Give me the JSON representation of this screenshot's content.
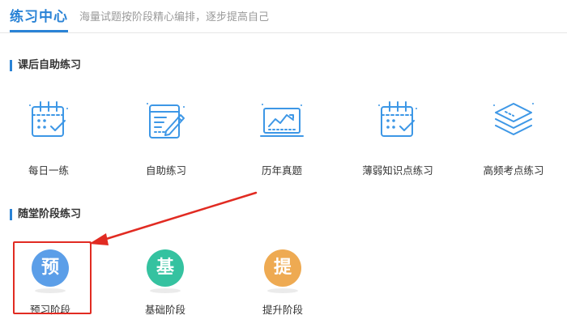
{
  "header": {
    "title": "练习中心",
    "subtitle": "海量试题按阶段精心编排，逐步提高自己"
  },
  "section_after_class": {
    "title": "课后自助练习",
    "items": [
      {
        "label": "每日一练",
        "icon": "calendar-check-icon"
      },
      {
        "label": "自助练习",
        "icon": "form-pencil-icon"
      },
      {
        "label": "历年真题",
        "icon": "chart-monitor-icon"
      },
      {
        "label": "薄弱知识点练习",
        "icon": "calendar-check-icon"
      },
      {
        "label": "高频考点练习",
        "icon": "layers-icon"
      }
    ]
  },
  "section_stage": {
    "title": "随堂阶段练习",
    "items": [
      {
        "label": "预习阶段",
        "glyph": "预",
        "color": "#5b9ee8"
      },
      {
        "label": "基础阶段",
        "glyph": "基",
        "color": "#35c2a0"
      },
      {
        "label": "提升阶段",
        "glyph": "提",
        "color": "#eeaa52"
      }
    ]
  },
  "colors": {
    "accent": "#2a83d6",
    "icon_stroke": "#3d97e6",
    "highlight": "#e12b22"
  }
}
